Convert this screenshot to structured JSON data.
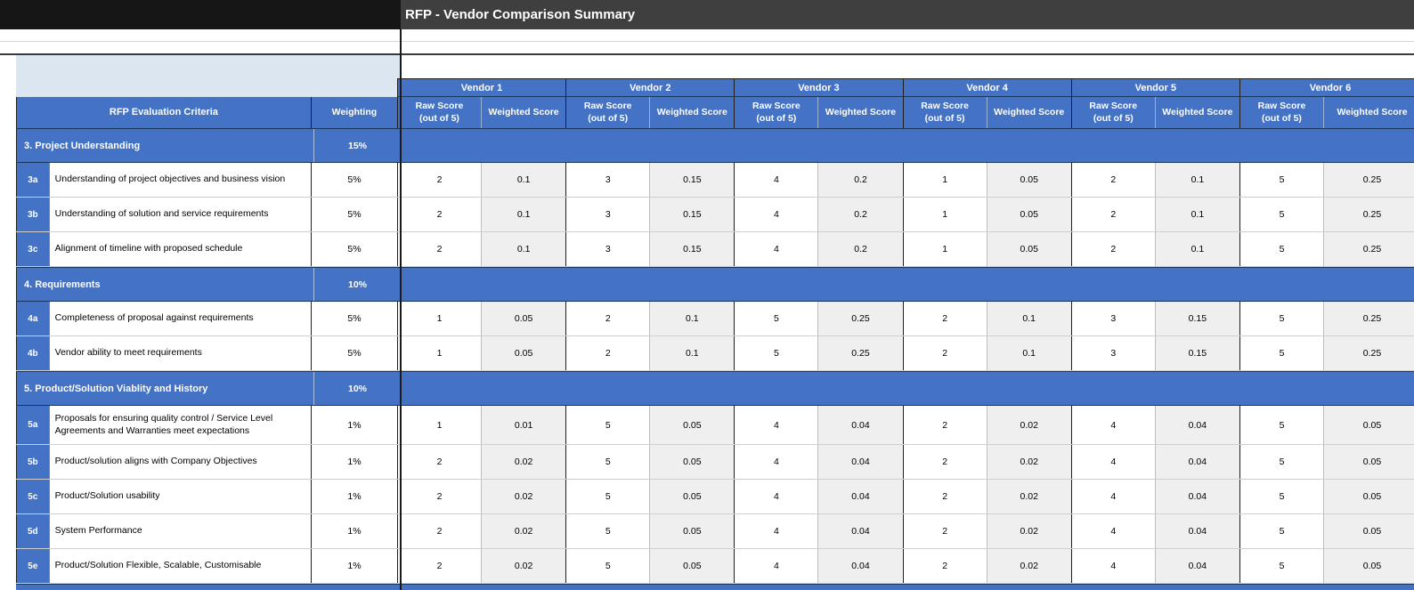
{
  "title": "RFP - Vendor Comparison Summary",
  "colors": {
    "accent_blue": "#4472C4",
    "title_bar_gray": "#3F3F3F",
    "weighted_col_gray": "#EFEFEF"
  },
  "table": {
    "criteria_header": "RFP Evaluation Criteria",
    "weighting_header": "Weighting",
    "raw_score_header": "Raw Score\n(out of 5)",
    "weighted_score_header": "Weighted Score",
    "vendors": [
      "Vendor 1",
      "Vendor 2",
      "Vendor 3",
      "Vendor 4",
      "Vendor 5",
      "Vendor 6"
    ],
    "sections": [
      {
        "label": "3. Project Understanding",
        "weighting": "15%",
        "rows": [
          {
            "id": "3a",
            "criteria": "Understanding of project objectives and business vision",
            "weighting": "5%",
            "raw": [
              "2",
              "3",
              "4",
              "1",
              "2",
              "5"
            ],
            "weighted": [
              "0.1",
              "0.15",
              "0.2",
              "0.05",
              "0.1",
              "0.25"
            ]
          },
          {
            "id": "3b",
            "criteria": "Understanding of solution and service requirements",
            "weighting": "5%",
            "raw": [
              "2",
              "3",
              "4",
              "1",
              "2",
              "5"
            ],
            "weighted": [
              "0.1",
              "0.15",
              "0.2",
              "0.05",
              "0.1",
              "0.25"
            ]
          },
          {
            "id": "3c",
            "criteria": "Alignment of timeline with proposed schedule",
            "weighting": "5%",
            "raw": [
              "2",
              "3",
              "4",
              "1",
              "2",
              "5"
            ],
            "weighted": [
              "0.1",
              "0.15",
              "0.2",
              "0.05",
              "0.1",
              "0.25"
            ]
          }
        ]
      },
      {
        "label": "4. Requirements",
        "weighting": "10%",
        "rows": [
          {
            "id": "4a",
            "criteria": "Completeness of proposal against requirements",
            "weighting": "5%",
            "raw": [
              "1",
              "2",
              "5",
              "2",
              "3",
              "5"
            ],
            "weighted": [
              "0.05",
              "0.1",
              "0.25",
              "0.1",
              "0.15",
              "0.25"
            ]
          },
          {
            "id": "4b",
            "criteria": "Vendor ability to meet requirements",
            "weighting": "5%",
            "raw": [
              "1",
              "2",
              "5",
              "2",
              "3",
              "5"
            ],
            "weighted": [
              "0.05",
              "0.1",
              "0.25",
              "0.1",
              "0.15",
              "0.25"
            ]
          }
        ]
      },
      {
        "label": "5. Product/Solution Viablity and History",
        "weighting": "10%",
        "rows": [
          {
            "id": "5a",
            "criteria": "Proposals for ensuring quality control / Service Level Agreements and Warranties meet expectations",
            "weighting": "1%",
            "raw": [
              "1",
              "5",
              "4",
              "2",
              "4",
              "5"
            ],
            "weighted": [
              "0.01",
              "0.05",
              "0.04",
              "0.02",
              "0.04",
              "0.05"
            ],
            "tall": true
          },
          {
            "id": "5b",
            "criteria": "Product/solution aligns with Company Objectives",
            "weighting": "1%",
            "raw": [
              "2",
              "5",
              "4",
              "2",
              "4",
              "5"
            ],
            "weighted": [
              "0.02",
              "0.05",
              "0.04",
              "0.02",
              "0.04",
              "0.05"
            ]
          },
          {
            "id": "5c",
            "criteria": "Product/Solution usability",
            "weighting": "1%",
            "raw": [
              "2",
              "5",
              "4",
              "2",
              "4",
              "5"
            ],
            "weighted": [
              "0.02",
              "0.05",
              "0.04",
              "0.02",
              "0.04",
              "0.05"
            ]
          },
          {
            "id": "5d",
            "criteria": "System Performance",
            "weighting": "1%",
            "raw": [
              "2",
              "5",
              "4",
              "2",
              "4",
              "5"
            ],
            "weighted": [
              "0.02",
              "0.05",
              "0.04",
              "0.02",
              "0.04",
              "0.05"
            ]
          },
          {
            "id": "5e",
            "criteria": "Product/Solution Flexible, Scalable, Customisable",
            "weighting": "1%",
            "raw": [
              "2",
              "5",
              "4",
              "2",
              "4",
              "5"
            ],
            "weighted": [
              "0.02",
              "0.05",
              "0.04",
              "0.02",
              "0.04",
              "0.05"
            ]
          }
        ]
      }
    ]
  }
}
